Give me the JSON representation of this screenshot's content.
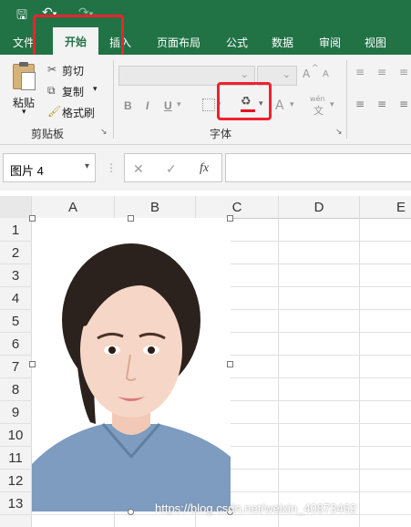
{
  "quick_access": {
    "save_icon": "save-icon",
    "undo_icon": "undo-icon",
    "redo_icon": "redo-icon"
  },
  "tabs": [
    {
      "label": "文件",
      "active": false
    },
    {
      "label": "开始",
      "active": true
    },
    {
      "label": "插入",
      "active": false
    },
    {
      "label": "页面布局",
      "active": false
    },
    {
      "label": "公式",
      "active": false
    },
    {
      "label": "数据",
      "active": false
    },
    {
      "label": "审阅",
      "active": false
    },
    {
      "label": "视图",
      "active": false
    }
  ],
  "clipboard": {
    "paste_label": "粘贴",
    "cut_label": "剪切",
    "copy_label": "复制",
    "format_painter_label": "格式刷",
    "group_label": "剪贴板"
  },
  "font_group": {
    "bold": "B",
    "italic": "I",
    "underline": "U",
    "grow_label": "A",
    "shrink_label": "A",
    "font_color_label": "A",
    "phonetic_label": "wén",
    "phonetic_char": "文",
    "group_label": "字体",
    "highlight_color": "#e81123"
  },
  "formula_bar": {
    "name_box_value": "图片 4",
    "cancel_icon": "✕",
    "enter_icon": "✓",
    "fx_label": "fx",
    "formula_value": ""
  },
  "columns": [
    "A",
    "B",
    "C",
    "D",
    "E"
  ],
  "rows": [
    "1",
    "2",
    "3",
    "4",
    "5",
    "6",
    "7",
    "8",
    "9",
    "10",
    "11",
    "12",
    "13"
  ],
  "watermark": "https://blog.csdn.net/weixin_40873462",
  "colors": {
    "excel_green": "#217346",
    "highlight_red": "#f0212e"
  }
}
